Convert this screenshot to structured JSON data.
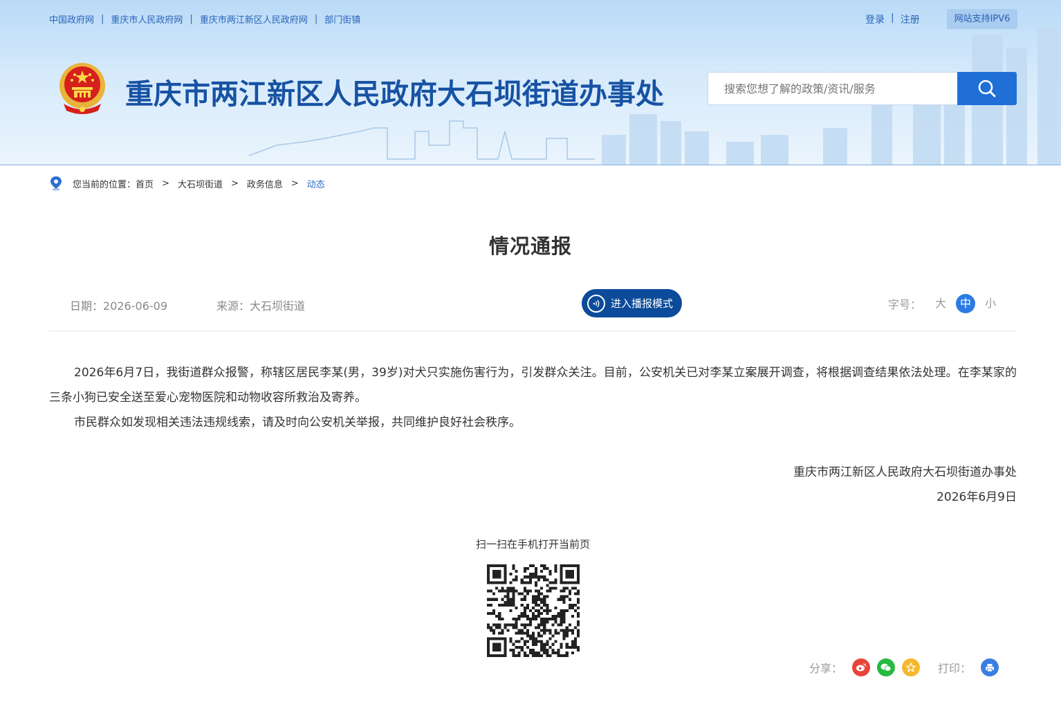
{
  "header": {
    "top_links": [
      "中国政府网",
      "重庆市人民政府网",
      "重庆市两江新区人民政府网",
      "部门街镇"
    ],
    "login": "登录",
    "register": "注册",
    "ipv6": "网站支持IPV6",
    "site_title": "重庆市两江新区人民政府大石坝街道办事处",
    "search_placeholder": "搜索您想了解的政策/资讯/服务"
  },
  "breadcrumb": {
    "prefix": "您当前的位置：",
    "items": [
      "首页",
      "大石坝街道",
      "政务信息"
    ],
    "current": "动态",
    "separator": ">"
  },
  "article": {
    "title": "情况通报",
    "date_label": "日期：",
    "date": "2026-06-09",
    "source_label": "来源：",
    "source": "大石坝街道",
    "broadcast_label": "进入播报模式",
    "font_label": "字号：",
    "font_sizes": [
      "大",
      "中",
      "小"
    ],
    "paragraphs": [
      "2026年6月7日，我街道群众报警，称辖区居民李某(男，39岁)对犬只实施伤害行为，引发群众关注。目前，公安机关已对李某立案展开调查，将根据调查结果依法处理。在李某家的三条小狗已安全送至爱心宠物医院和动物收容所救治及寄养。",
      "市民群众如发现相关违法违规线索，请及时向公安机关举报，共同维护良好社会秩序。"
    ],
    "sign_org": "重庆市两江新区人民政府大石坝街道办事处",
    "sign_date": "2026年6月9日"
  },
  "footer": {
    "qr_caption": "扫一扫在手机打开当前页",
    "share_label": "分享：",
    "print_label": "打印："
  },
  "colors": {
    "brand_blue": "#1752a3",
    "accent": "#1f6fd6",
    "weibo": "#e6463a",
    "wechat": "#27b941",
    "favorite": "#f5b82e",
    "print": "#3a7fe0"
  }
}
